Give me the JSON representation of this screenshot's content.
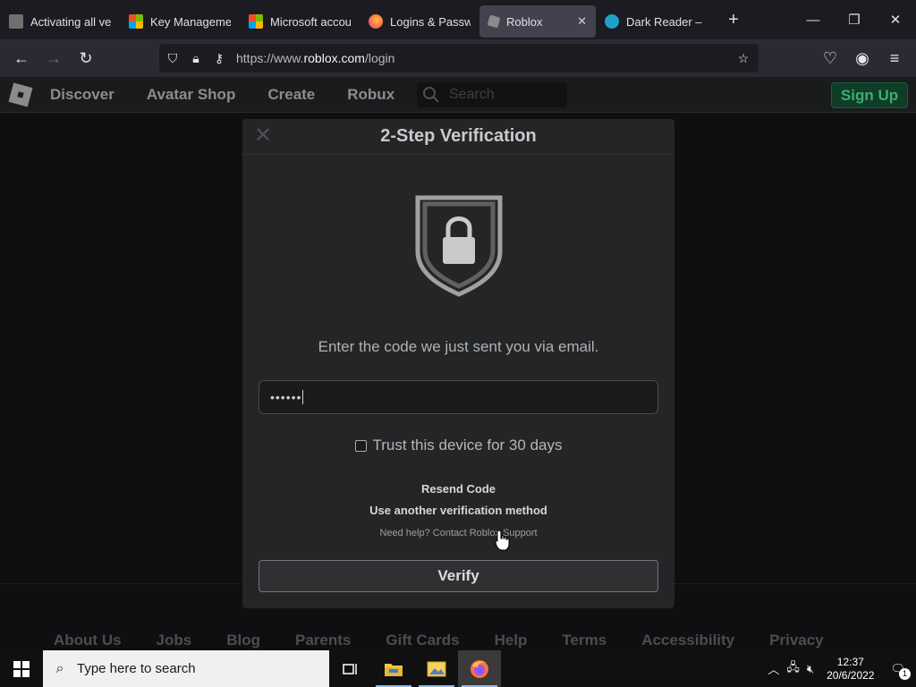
{
  "browser": {
    "tabs": [
      {
        "title": "Activating all ver",
        "favicon_color": "#6f6f6f"
      },
      {
        "title": "Key Management",
        "favicon_color": "#f25022"
      },
      {
        "title": "Microsoft accoun",
        "favicon_color": "#f25022"
      },
      {
        "title": "Logins & Passwo",
        "favicon_color": "#ff7139"
      },
      {
        "title": "Roblox",
        "favicon_color": "#8a8b8d",
        "active": true
      },
      {
        "title": "Dark Reader – Ge",
        "favicon_color": "#1ea0c8"
      }
    ],
    "url_scheme": "https://www.",
    "url_host": "roblox.com",
    "url_path": "/login"
  },
  "roblox_header": {
    "nav": [
      "Discover",
      "Avatar Shop",
      "Create",
      "Robux"
    ],
    "search_placeholder": "Search",
    "signup_label": "Sign Up"
  },
  "modal": {
    "title": "2-Step Verification",
    "instruction": "Enter the code we just sent you via email.",
    "code_value": "••••••",
    "trust_label": "Trust this device for 30 days",
    "resend_label": "Resend Code",
    "other_method_label": "Use another verification method",
    "help_text": "Need help? Contact Roblox Support",
    "verify_label": "Verify"
  },
  "footer": {
    "links": [
      "About Us",
      "Jobs",
      "Blog",
      "Parents",
      "Gift Cards",
      "Help",
      "Terms",
      "Accessibility",
      "Privacy"
    ]
  },
  "taskbar": {
    "search_placeholder": "Type here to search",
    "time": "12:37",
    "date": "20/6/2022",
    "notification_count": "1"
  },
  "colors": {
    "signup_green": "#3fae71",
    "page_bg": "#0e0f10",
    "modal_bg": "#232527"
  }
}
